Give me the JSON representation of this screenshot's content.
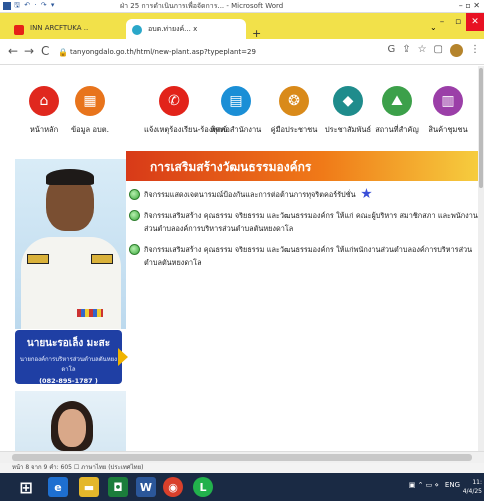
{
  "word": {
    "quick_access": "🖫 ↶ · ↷ ▾",
    "title": "ฝ่า 25 การดำเนินการเพื่อจัดการ... - Microsoft Word",
    "buttons": "– ▫ ✕"
  },
  "browser": {
    "tabs": [
      {
        "label": "INN ARCFTUKA ..",
        "favicon_color": "#e62117"
      },
      {
        "label": "อบต.ท่ายงค์... x",
        "favicon_color": "#2aa7c9"
      }
    ],
    "new_tab": "+",
    "tab_chevron": "⌄",
    "window_buttons": [
      "–",
      "▫",
      "✕"
    ],
    "nav": {
      "back": "←",
      "forward": "→",
      "reload": "C"
    },
    "url": "tanyongdalo.go.th/html/new-plant.asp?typeplant=29",
    "right_icons": [
      "G",
      "⇪",
      "☆",
      "▢",
      "⋮"
    ]
  },
  "menu": [
    {
      "label": "หน้าหลัก",
      "icon": "home-icon",
      "glyph": "⌂",
      "color": "#e0281e"
    },
    {
      "label": "ข้อมูล อบต.",
      "icon": "building-icon",
      "glyph": "▦",
      "color": "#e8741c"
    },
    {
      "label": "แจ้งเหตุร้องเรียน-ร้องทุกข์",
      "icon": "phone-icon",
      "glyph": "✆",
      "color": "#e2231a"
    },
    {
      "label": "ติดต่อสำนักงาน",
      "icon": "office-icon",
      "glyph": "▤",
      "color": "#1b8fd6"
    },
    {
      "label": "คู่มือประชาชน",
      "icon": "book-icon",
      "glyph": "❂",
      "color": "#d98a1a"
    },
    {
      "label": "ประชาสัมพันธ์",
      "icon": "droplet-icon",
      "glyph": "◆",
      "color": "#1f8c8c"
    },
    {
      "label": "สถานที่สำคัญ",
      "icon": "landscape-icon",
      "glyph": "⛰",
      "color": "#3ca04a"
    },
    {
      "label": "สินค้าชุมชน",
      "icon": "shop-icon",
      "glyph": "▥",
      "color": "#9b3fa8"
    }
  ],
  "profile": {
    "name": "นายนะรอเล็ง มะสะ",
    "position": "นายกองค์การบริหารส่วนตำบลตันหยงดาโล",
    "phone": "(082-895-1787 )"
  },
  "content": {
    "header": "การเสริมสร้างวัฒนธรรมองค์กร",
    "items": [
      {
        "text": "กิจกรรมแสดงเจตนารมณ์ป้องกันและการต่อต้านการทุจริตคอร์รัปชั่น",
        "new": true
      },
      {
        "text": "กิจกรรมเสริมสร้าง คุณธรรม จริยธรรม และวัฒนธรรมองค์กร ให้แก่ คณะผู้บริหาร สมาชิกสภา และพนักงานส่วนตำบลองค์การบริหารส่วนตำบลตันหยงดาโล",
        "new": false
      },
      {
        "text": "กิจกรรมเสริมสร้าง คุณธรรม จริยธรรม และวัฒนธรรมองค์กร ให้แก่พนักงานส่วนตำบลองค์การบริหารส่วนตำบลตันหยงดาโล",
        "new": false
      }
    ]
  },
  "word_status": "หน้า 8 จาก 9    คำ: 605    ☐    ภาษาไทย (ประเทศไทย)",
  "taskbar": {
    "apps": [
      {
        "name": "windows-start",
        "glyph": "⊞",
        "color": "#1a2a44"
      },
      {
        "name": "edge",
        "glyph": "e",
        "color": "#1e6fd0"
      },
      {
        "name": "file-explorer",
        "glyph": "▬",
        "color": "#e4b72b"
      },
      {
        "name": "onenote-like",
        "glyph": "◘",
        "color": "#1b7d3b"
      },
      {
        "name": "word",
        "glyph": "W",
        "color": "#2b579a"
      },
      {
        "name": "chrome",
        "glyph": "◉",
        "color": "#d9402b"
      },
      {
        "name": "line",
        "glyph": "L",
        "color": "#22b14c"
      }
    ],
    "tray_lang": "ENG",
    "tray_icons": "▣ ⌃ ▭ ⋄",
    "time": "11:",
    "date": "4/4/25"
  }
}
